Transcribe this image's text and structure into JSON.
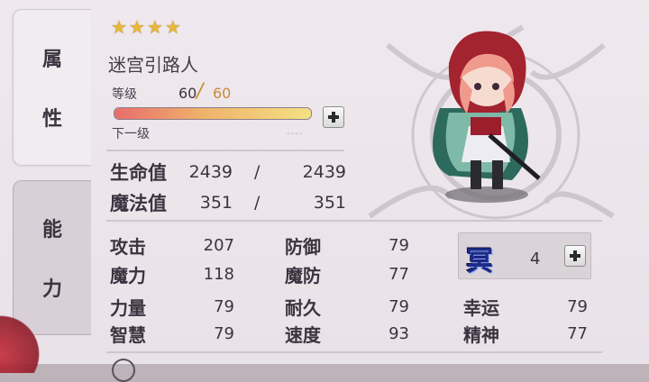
{
  "tabs": {
    "attributes": "属\n\n性",
    "abilities": "能\n\n力",
    "attributes_chars": [
      "属",
      "性"
    ],
    "abilities_chars": [
      "能",
      "力"
    ]
  },
  "character": {
    "stars": [
      "★",
      "★",
      "★",
      "★"
    ],
    "name": "迷宫引路人"
  },
  "level": {
    "label": "等级",
    "current": "60",
    "slash": "/",
    "max": "60",
    "next_label": "下一级",
    "next_value": "----",
    "exp_fraction": 1.0
  },
  "vitals": {
    "hp_label": "生命值",
    "hp_current": "2439",
    "hp_max": "2439",
    "mp_label": "魔法值",
    "mp_current": "351",
    "mp_max": "351",
    "slash": "/"
  },
  "stats": {
    "atk_label": "攻击",
    "atk": "207",
    "matk_label": "魔力",
    "matk": "118",
    "def_label": "防御",
    "def": "79",
    "mdef_label": "魔防",
    "mdef": "77",
    "str_label": "力量",
    "str": "79",
    "int_label": "智慧",
    "int": "79",
    "end_label": "耐久",
    "end": "79",
    "spd_label": "速度",
    "spd": "93",
    "luck_label": "幸运",
    "luck": "79",
    "spirit_label": "精神",
    "spirit": "77"
  },
  "element": {
    "glyph": "冥",
    "value": "4"
  },
  "colors": {
    "accent_gold": "#c98a3a",
    "star": "#e9b73a",
    "element_blue": "#1e2a8a"
  },
  "icons": {
    "plus": "plus-icon",
    "star": "star-icon",
    "emblem": "thorn-emblem"
  }
}
